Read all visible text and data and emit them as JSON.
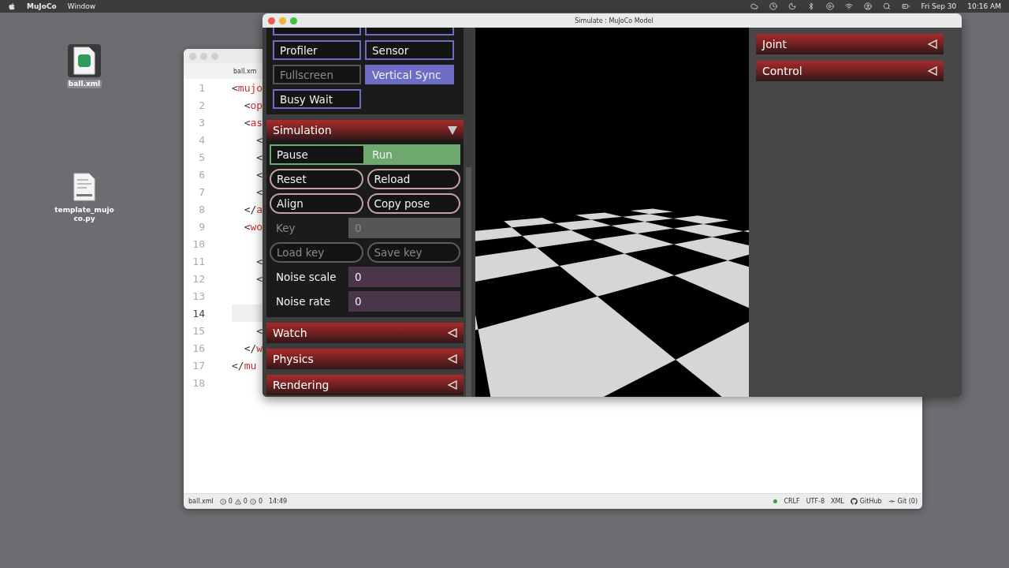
{
  "menu_bar": {
    "app": "MuJoCo",
    "menus": [
      "Window"
    ],
    "date": "Fri Sep 30",
    "time": "10:16 AM"
  },
  "desktop_icons": [
    {
      "label": "ball.xml",
      "kind": "xml",
      "selected": true
    },
    {
      "label": "template_mujoco.py",
      "kind": "python",
      "selected": false
    }
  ],
  "editor": {
    "tab": "ball.xm",
    "lines": [
      {
        "number": "1",
        "code": "<mujo",
        "current": false
      },
      {
        "number": "2",
        "code": "  <op",
        "current": false
      },
      {
        "number": "3",
        "code": "  <as",
        "current": false
      },
      {
        "number": "4",
        "code": "    <",
        "current": false
      },
      {
        "number": "5",
        "code": "    <",
        "current": false
      },
      {
        "number": "6",
        "code": "    <",
        "current": false
      },
      {
        "number": "7",
        "code": "    <",
        "current": false
      },
      {
        "number": "8",
        "code": "  </a",
        "current": false
      },
      {
        "number": "9",
        "code": "  <wo",
        "current": false
      },
      {
        "number": "10",
        "current": false
      },
      {
        "number": "11",
        "code": "    <",
        "current": false
      },
      {
        "number": "12",
        "code": "    <",
        "current": false
      },
      {
        "number": "13",
        "current": false
      },
      {
        "number": "14",
        "current": true
      },
      {
        "number": "15",
        "code": "    <",
        "current": false
      },
      {
        "number": "16",
        "code": "  </w",
        "current": false
      },
      {
        "number": "17",
        "code": "</mu",
        "current": false
      },
      {
        "number": "18",
        "current": false
      }
    ],
    "status": {
      "file": "ball.xml",
      "errors": "0",
      "warnings": "0",
      "infos": "0",
      "position": "14:49",
      "line_ending": "CRLF",
      "encoding": "UTF-8",
      "language": "XML",
      "github": "GitHub",
      "git": "Git (0)"
    }
  },
  "simulate": {
    "title": "Simulate : MuJoCo Model",
    "option_buttons": [
      {
        "on": false,
        "disabled": false
      },
      {
        "on": false,
        "disabled": false
      },
      {
        "label": "Profiler",
        "on": false,
        "disabled": false
      },
      {
        "label": "Sensor",
        "on": false,
        "disabled": false
      },
      {
        "label": "Fullscreen",
        "on": false,
        "disabled": true
      },
      {
        "label": "Vertical Sync",
        "on": true,
        "disabled": false
      },
      {
        "label": "Busy Wait",
        "on": false,
        "disabled": false
      }
    ],
    "simulation": {
      "title": "Simulation",
      "expanded": true,
      "rows": [
        {
          "kind": "radio",
          "items": [
            {
              "label": "Pause",
              "selected": false
            },
            {
              "label": "Run",
              "selected": true
            }
          ]
        },
        {
          "kind": "buttons",
          "items": [
            {
              "label": "Reset",
              "disabled": false
            },
            {
              "label": "Reload",
              "disabled": false
            }
          ]
        },
        {
          "kind": "buttons",
          "items": [
            {
              "label": "Align",
              "disabled": false
            },
            {
              "label": "Copy pose",
              "disabled": false
            }
          ]
        },
        {
          "kind": "field",
          "label": "Key",
          "value": "0",
          "disabled": true
        },
        {
          "kind": "buttons",
          "items": [
            {
              "label": "Load key",
              "disabled": true
            },
            {
              "label": "Save key",
              "disabled": true
            }
          ]
        },
        {
          "kind": "field",
          "label": "Noise scale",
          "value": "0",
          "disabled": false
        },
        {
          "kind": "field",
          "label": "Noise rate",
          "value": "0",
          "disabled": false
        }
      ]
    },
    "sections": [
      {
        "title": "Watch",
        "expanded": false
      },
      {
        "title": "Physics",
        "expanded": false
      },
      {
        "title": "Rendering",
        "expanded": false
      }
    ],
    "right_sections": [
      {
        "title": "Joint",
        "expanded": false
      },
      {
        "title": "Control",
        "expanded": false
      }
    ]
  }
}
